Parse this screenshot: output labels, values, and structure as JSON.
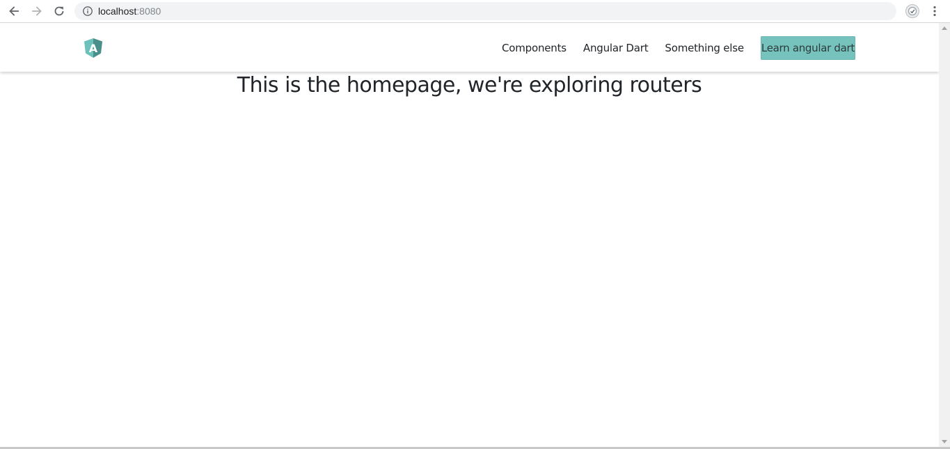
{
  "browser": {
    "url_host": "localhost",
    "url_port": ":8080",
    "back_icon": "back-arrow-icon",
    "forward_icon": "forward-arrow-icon",
    "reload_icon": "reload-icon",
    "info_icon": "info-icon",
    "star_icon": "star-icon",
    "extension_icon": "extension-icon",
    "menu_icon": "kebab-menu-icon"
  },
  "navbar": {
    "logo_icon": "angular-logo-icon",
    "logo_letter": "A",
    "links": [
      "Components",
      "Angular Dart",
      "Something else"
    ],
    "cta_label": "Learn angular dart"
  },
  "main": {
    "title": "This is the homepage, we're exploring routers"
  },
  "colors": {
    "cta_background": "#76c3be",
    "logo_light": "#6cc1bb",
    "logo_dark": "#4b8f8b",
    "text": "#212529"
  }
}
